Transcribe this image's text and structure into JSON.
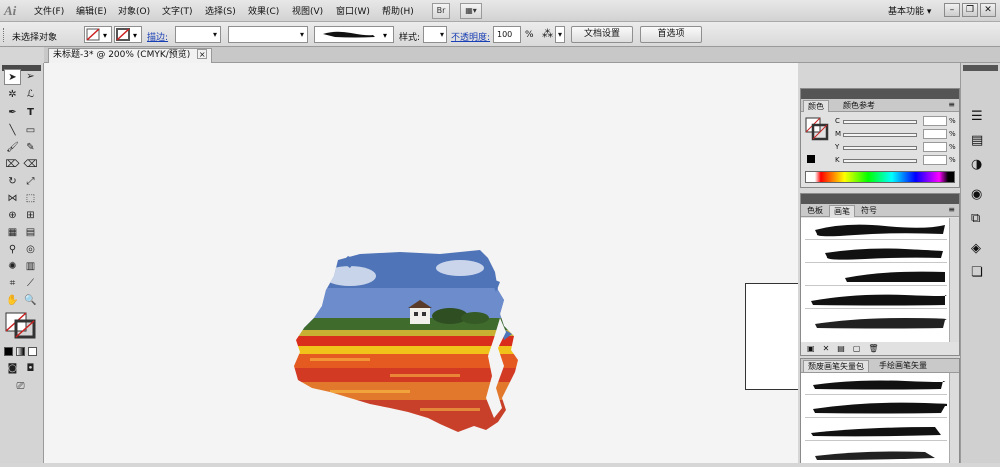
{
  "app": {
    "logo": "Ai"
  },
  "menubar": {
    "items": [
      "文件(F)",
      "编辑(E)",
      "对象(O)",
      "文字(T)",
      "选择(S)",
      "效果(C)",
      "视图(V)",
      "窗口(W)",
      "帮助(H)"
    ],
    "bridge_button": "Br",
    "workspace": "基本功能 ▾"
  },
  "controlbar": {
    "selection_status": "未选择对象",
    "stroke_label": "描边:",
    "style_label": "样式:",
    "opacity_label": "不透明度:",
    "opacity_value": "100",
    "opacity_unit": "%",
    "doc_settings_button": "文档设置",
    "preferences_button": "首选项"
  },
  "document_tab": {
    "title": "未标题-3* @ 200% (CMYK/预览)",
    "close": "×"
  },
  "color_panel": {
    "tabs": [
      "颜色",
      "颜色参考"
    ],
    "channels": [
      "C",
      "M",
      "Y",
      "K"
    ],
    "unit": "%"
  },
  "brush_panel": {
    "tabs": [
      "色板",
      "画笔",
      "符号"
    ],
    "library_tabs": [
      "颓废画笔矢量包",
      "手绘画笔矢量"
    ]
  },
  "colors": {
    "canvas": "#f4f4f4",
    "chrome": "#d6d6d6",
    "link": "#1a3fb4",
    "stroke_red": "#cc2020"
  }
}
